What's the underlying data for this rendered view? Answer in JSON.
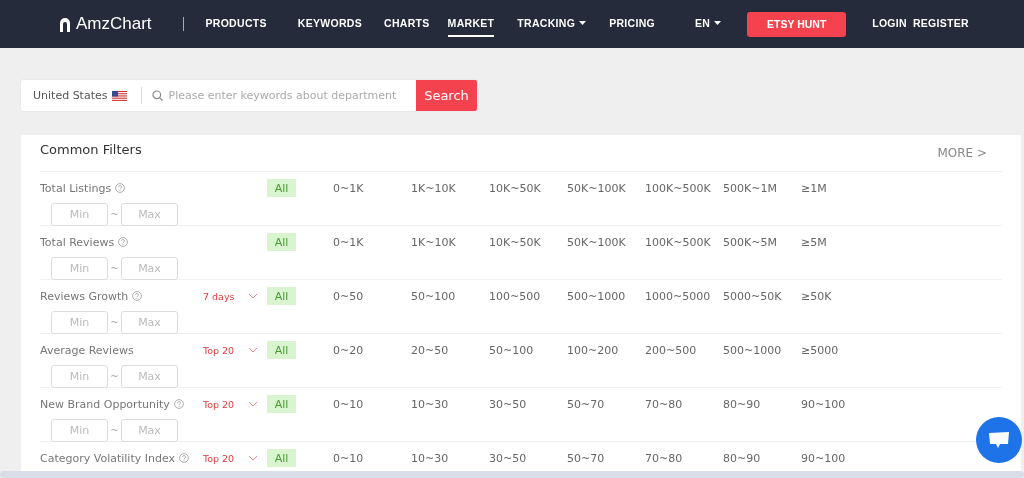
{
  "nav": {
    "logo": "AmzChart",
    "items": [
      {
        "label": "PRODUCTS",
        "selected": false,
        "dropdown": false
      },
      {
        "label": "KEYWORDS",
        "selected": false,
        "dropdown": false
      },
      {
        "label": "CHARTS",
        "selected": false,
        "dropdown": false
      },
      {
        "label": "MARKET",
        "selected": true,
        "dropdown": false
      },
      {
        "label": "TRACKING",
        "selected": false,
        "dropdown": true
      },
      {
        "label": "PRICING",
        "selected": false,
        "dropdown": false
      }
    ],
    "language": "EN",
    "cta": "ETSY HUNT",
    "login": "LOGIN",
    "register": "REGISTER"
  },
  "search": {
    "country": "United States",
    "placeholder": "Please enter keywords about department",
    "button": "Search"
  },
  "filters": {
    "title": "Common Filters",
    "more": "MORE >",
    "rows": [
      {
        "label": "Total Listings",
        "help": true,
        "range": {
          "min_placeholder": "Min",
          "sep": "~",
          "max_placeholder": "Max"
        },
        "options": [
          {
            "label": "All",
            "selected": true
          },
          {
            "label": "0~1K",
            "selected": false
          },
          {
            "label": "1K~10K",
            "selected": false
          },
          {
            "label": "10K~50K",
            "selected": false
          },
          {
            "label": "50K~100K",
            "selected": false
          },
          {
            "label": "100K~500K",
            "selected": false
          },
          {
            "label": "500K~1M",
            "selected": false
          },
          {
            "label": "≥1M",
            "selected": false
          }
        ]
      },
      {
        "label": "Total Reviews",
        "help": true,
        "range": {
          "min_placeholder": "Min",
          "sep": "~",
          "max_placeholder": "Max"
        },
        "options": [
          {
            "label": "All",
            "selected": true
          },
          {
            "label": "0~1K",
            "selected": false
          },
          {
            "label": "1K~10K",
            "selected": false
          },
          {
            "label": "10K~50K",
            "selected": false
          },
          {
            "label": "50K~100K",
            "selected": false
          },
          {
            "label": "100K~500K",
            "selected": false
          },
          {
            "label": "500K~5M",
            "selected": false
          },
          {
            "label": "≥5M",
            "selected": false
          }
        ]
      },
      {
        "label": "Reviews Growth",
        "help": true,
        "period": "7 days",
        "range": {
          "min_placeholder": "Min",
          "sep": "~",
          "max_placeholder": "Max"
        },
        "options": [
          {
            "label": "All",
            "selected": true
          },
          {
            "label": "0~50",
            "selected": false
          },
          {
            "label": "50~100",
            "selected": false
          },
          {
            "label": "100~500",
            "selected": false
          },
          {
            "label": "500~1000",
            "selected": false
          },
          {
            "label": "1000~5000",
            "selected": false
          },
          {
            "label": "5000~50K",
            "selected": false
          },
          {
            "label": "≥50K",
            "selected": false
          }
        ]
      },
      {
        "label": "Average Reviews",
        "help": false,
        "period": "Top 20",
        "range": {
          "min_placeholder": "Min",
          "sep": "~",
          "max_placeholder": "Max"
        },
        "options": [
          {
            "label": "All",
            "selected": true
          },
          {
            "label": "0~20",
            "selected": false
          },
          {
            "label": "20~50",
            "selected": false
          },
          {
            "label": "50~100",
            "selected": false
          },
          {
            "label": "100~200",
            "selected": false
          },
          {
            "label": "200~500",
            "selected": false
          },
          {
            "label": "500~1000",
            "selected": false
          },
          {
            "label": "≥5000",
            "selected": false
          }
        ]
      },
      {
        "label": "New Brand Opportunity",
        "help": true,
        "period": "Top 20",
        "range": {
          "min_placeholder": "Min",
          "sep": "~",
          "max_placeholder": "Max"
        },
        "options": [
          {
            "label": "All",
            "selected": true
          },
          {
            "label": "0~10",
            "selected": false
          },
          {
            "label": "10~30",
            "selected": false
          },
          {
            "label": "30~50",
            "selected": false
          },
          {
            "label": "50~70",
            "selected": false
          },
          {
            "label": "70~80",
            "selected": false
          },
          {
            "label": "80~90",
            "selected": false
          },
          {
            "label": "90~100",
            "selected": false
          }
        ]
      },
      {
        "label": "Category Volatility Index",
        "help": true,
        "period": "Top 20",
        "options": [
          {
            "label": "All",
            "selected": true
          },
          {
            "label": "0~10",
            "selected": false
          },
          {
            "label": "10~30",
            "selected": false
          },
          {
            "label": "30~50",
            "selected": false
          },
          {
            "label": "50~70",
            "selected": false
          },
          {
            "label": "70~80",
            "selected": false
          },
          {
            "label": "80~90",
            "selected": false
          },
          {
            "label": "90~100",
            "selected": false
          }
        ]
      }
    ]
  }
}
